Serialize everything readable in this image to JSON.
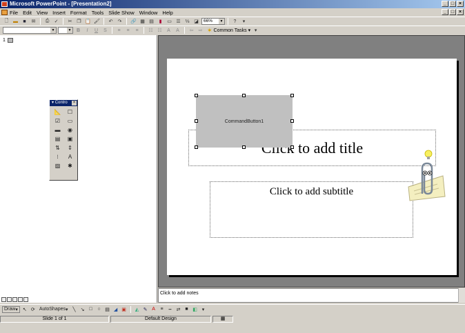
{
  "window": {
    "title": "Microsoft PowerPoint - [Presentation2]",
    "controls": [
      "_",
      "□",
      "×"
    ]
  },
  "menu": {
    "items": [
      "File",
      "Edit",
      "View",
      "Insert",
      "Format",
      "Tools",
      "Slide Show",
      "Window",
      "Help"
    ]
  },
  "toolbar": {
    "zoom": "66%",
    "common_tasks": "Common Tasks"
  },
  "control_toolbox": {
    "title": "Contro"
  },
  "slide": {
    "number": "1",
    "title_placeholder": "Click to add title",
    "subtitle_placeholder": "Click to add subtitle",
    "command_button": "CommandButton1"
  },
  "notes": {
    "placeholder": "Click to add notes"
  },
  "drawing": {
    "draw": "Draw",
    "autoshapes": "AutoShapes"
  },
  "status": {
    "slide": "Slide 1 of 1",
    "design": "Default Design"
  }
}
